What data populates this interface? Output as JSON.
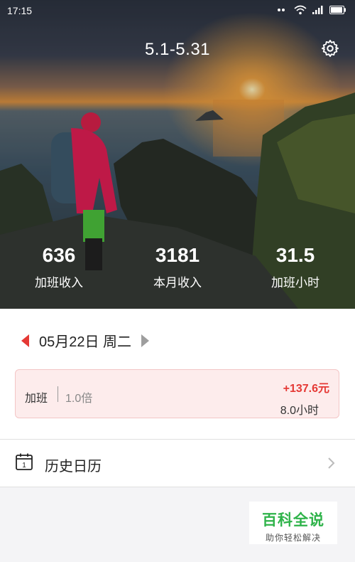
{
  "status_bar": {
    "time": "17:15"
  },
  "header": {
    "period": "5.1-5.31",
    "settings_icon": "gear-icon"
  },
  "stats": [
    {
      "value": "636",
      "label": "加班收入"
    },
    {
      "value": "3181",
      "label": "本月收入"
    },
    {
      "value": "31.5",
      "label": "加班小时"
    }
  ],
  "date_nav": {
    "date": "05月22日 周二"
  },
  "record": {
    "type": "加班",
    "multiplier": "1.0倍",
    "amount": "+137.6元",
    "hours": "8.0小时"
  },
  "history": {
    "label": "历史日历"
  },
  "watermark": {
    "line1": "百科全说",
    "line2": "助你轻松解决"
  },
  "colors": {
    "accent": "#e53935",
    "card_bg": "#fdecec",
    "watermark_green": "#2fb34a"
  }
}
